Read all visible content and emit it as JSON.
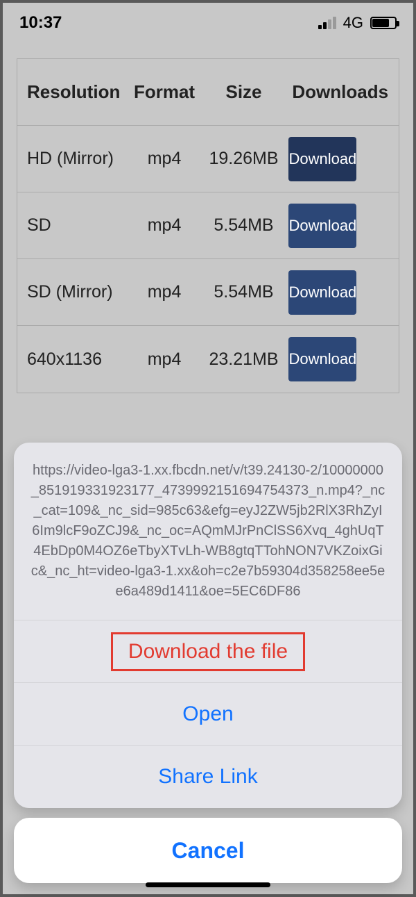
{
  "status": {
    "time": "10:37",
    "network_label": "4G"
  },
  "table": {
    "headers": {
      "resolution": "Resolution",
      "format": "Format",
      "size": "Size",
      "downloads": "Downloads"
    },
    "rows": [
      {
        "resolution": "HD (Mirror)",
        "format": "mp4",
        "size": "19.26MB",
        "button": "Download"
      },
      {
        "resolution": "SD",
        "format": "mp4",
        "size": "5.54MB",
        "button": "Download"
      },
      {
        "resolution": "SD (Mirror)",
        "format": "mp4",
        "size": "5.54MB",
        "button": "Download"
      },
      {
        "resolution": "640x1136",
        "format": "mp4",
        "size": "23.21MB",
        "button": "Download"
      }
    ]
  },
  "sheet": {
    "title": "https://video-lga3-1.xx.fbcdn.net/v/t39.24130-2/10000000_851919331923177_4739992151694754373_n.mp4?_nc_cat=109&_nc_sid=985c63&efg=eyJ2ZW5jb2RlX3RhZyI6Im9lcF9oZCJ9&_nc_oc=AQmMJrPnClSS6Xvq_4ghUqT4EbDp0M4OZ6eTbyXTvLh-WB8gtqTTohNON7VKZoixGic&_nc_ht=video-lga3-1.xx&oh=c2e7b59304d358258ee5ee6a489d1411&oe=5EC6DF86",
    "actions": {
      "download": "Download the file",
      "open": "Open",
      "share": "Share Link",
      "cancel": "Cancel"
    }
  }
}
